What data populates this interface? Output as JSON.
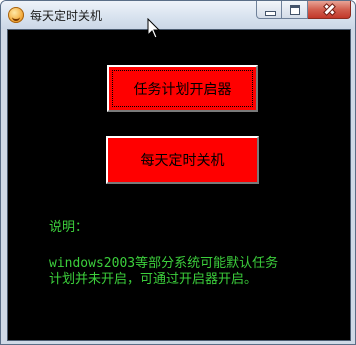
{
  "window": {
    "title": "每天定时关机"
  },
  "caption_buttons": {
    "minimize_icon": "minimize-icon",
    "maximize_icon": "maximize-icon",
    "close_icon": "close-icon"
  },
  "buttons": {
    "task_scheduler_label": "任务计划开启器",
    "daily_shutdown_label": "每天定时关机"
  },
  "note": {
    "heading": "说明：",
    "lines": [
      "windows2003等部分系统可能默认任务",
      "计划并未开启，可通过开启器开启。"
    ]
  },
  "colors": {
    "button_bg": "#ff0000",
    "client_bg": "#000000",
    "note_text": "#3ccf3c"
  }
}
